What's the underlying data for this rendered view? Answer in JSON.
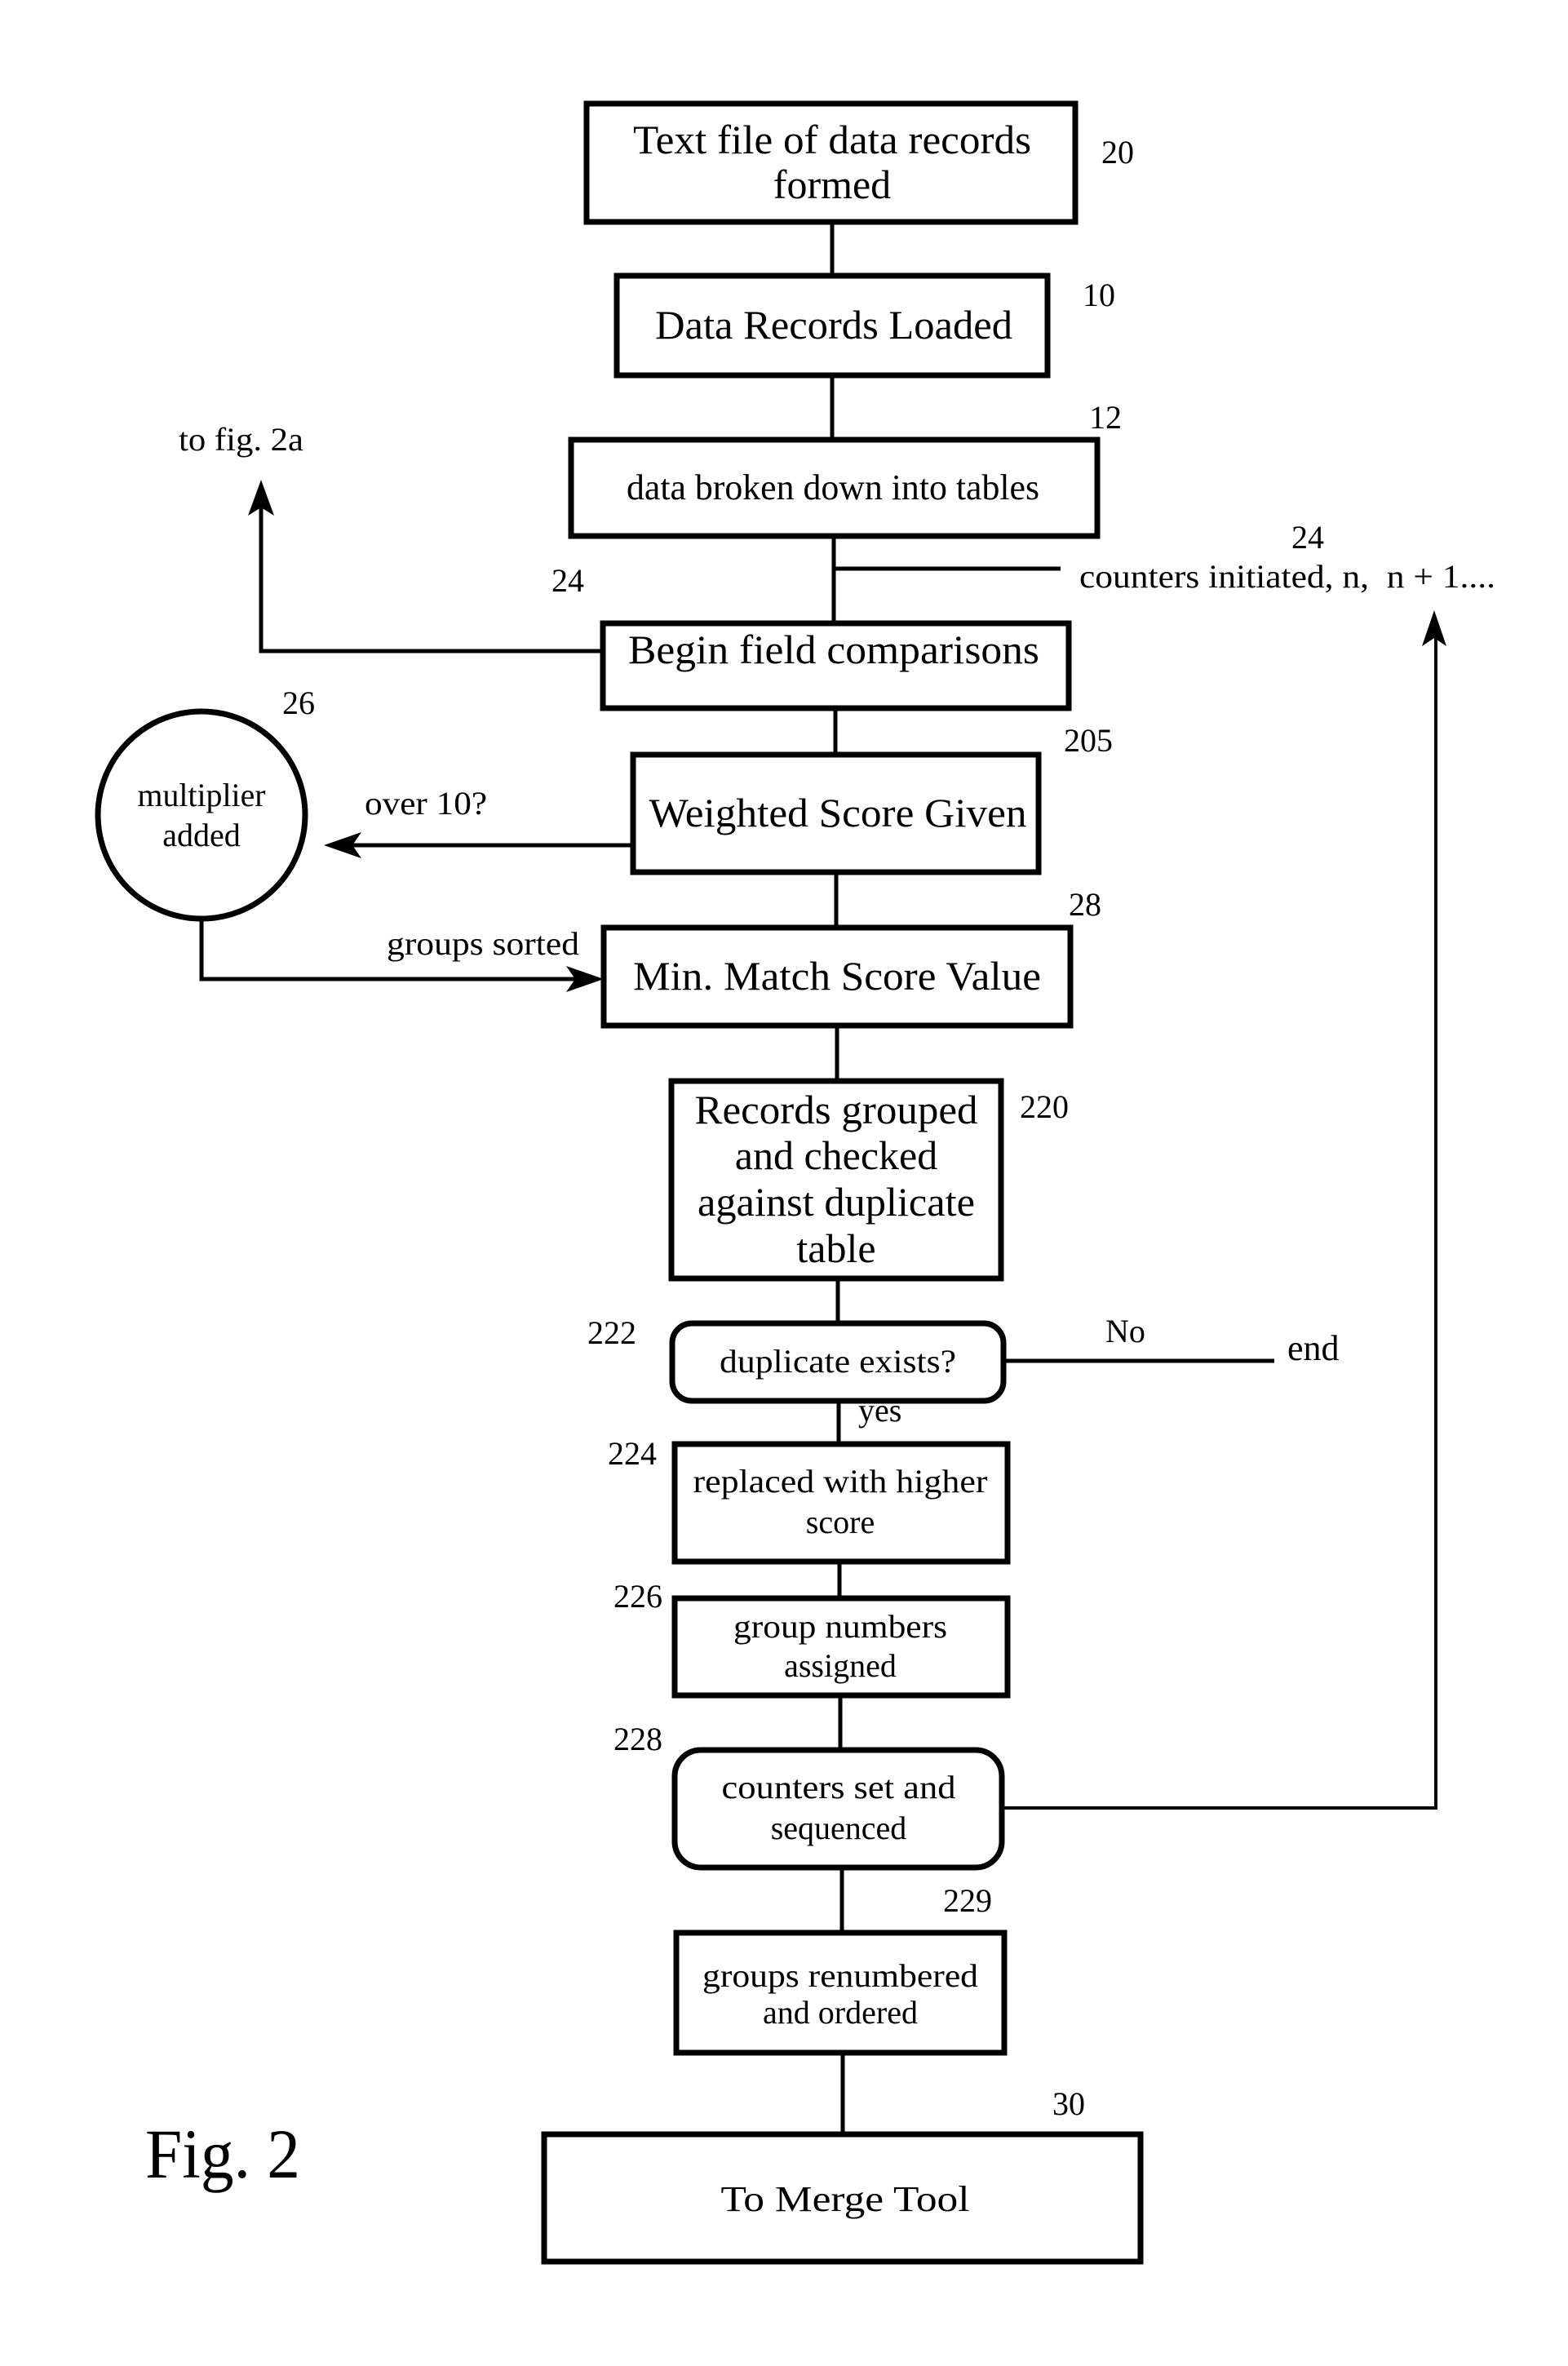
{
  "figure": {
    "caption": "Fig. 2",
    "nodes": {
      "text_file": {
        "ref": "20",
        "lines": [
          "Text file of data records",
          "formed"
        ]
      },
      "records_loaded": {
        "ref": "10",
        "lines": [
          "Data Records Loaded"
        ]
      },
      "broken_down": {
        "ref": "12",
        "lines": [
          "data broken down into tables"
        ]
      },
      "field_comparisons": {
        "ref": "24",
        "lines": [
          "Begin field comparisons"
        ]
      },
      "weighted_score": {
        "ref": "205",
        "lines": [
          "Weighted Score Given"
        ]
      },
      "multiplier": {
        "ref": "26",
        "lines": [
          "multiplier",
          "added"
        ]
      },
      "min_match": {
        "ref": "28",
        "lines": [
          "Min. Match Score Value"
        ]
      },
      "records_grouped": {
        "ref": "220",
        "lines": [
          "Records grouped",
          "and checked",
          "against duplicate",
          "table"
        ]
      },
      "duplicate_exists": {
        "ref": "222",
        "lines": [
          "duplicate exists?"
        ]
      },
      "replaced": {
        "ref": "224",
        "lines": [
          "replaced with higher",
          "score"
        ]
      },
      "group_numbers": {
        "ref": "226",
        "lines": [
          "group numbers",
          "assigned"
        ]
      },
      "counters_set": {
        "ref": "228",
        "lines": [
          "counters set and",
          "sequenced"
        ]
      },
      "renumbered": {
        "ref": "229",
        "lines": [
          "groups renumbered",
          "and ordered"
        ]
      },
      "merge_tool": {
        "ref": "30",
        "lines": [
          "To Merge Tool"
        ]
      }
    },
    "annotations": {
      "to_fig": "to fig. 2a",
      "counters_initiated_ref": "24",
      "counters_initiated": "counters initiated, n,  n + 1....",
      "over_10": "over 10?",
      "groups_sorted": "groups sorted",
      "no": "No",
      "end": "end",
      "yes": "yes"
    }
  }
}
